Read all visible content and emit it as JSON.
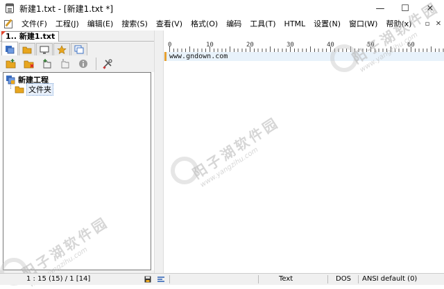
{
  "window": {
    "title": "新建1.txt - [新建1.txt *]",
    "controls": {
      "minimize": "—",
      "maximize": "☐",
      "close": "✕"
    }
  },
  "menu": {
    "items": [
      "文件(F)",
      "工程(J)",
      "编辑(E)",
      "搜索(S)",
      "查看(V)",
      "格式(O)",
      "编码",
      "工具(T)",
      "HTML",
      "设置(N)",
      "窗口(W)",
      "帮助(x)"
    ],
    "restore_icon": "▫",
    "close_icon": "✕"
  },
  "document_tab": {
    "label": "1.. 新建1.txt"
  },
  "panel_tabs": [
    {
      "icon": "project-icon"
    },
    {
      "icon": "folder-icon"
    },
    {
      "icon": "monitor-icon"
    },
    {
      "icon": "star-icon"
    },
    {
      "icon": "windows-icon"
    }
  ],
  "toolbar": {
    "buttons": [
      "add-folder-icon",
      "remove-folder-icon",
      "add-file-icon",
      "remove-file-icon",
      "info-icon",
      "tools-icon"
    ]
  },
  "tree": {
    "project": "新建工程",
    "folder": "文件夹"
  },
  "ruler": {
    "labels": [
      "0",
      "10",
      "20",
      "30",
      "40",
      "50",
      "60"
    ]
  },
  "editor": {
    "lines": [
      "www.gndown.com"
    ]
  },
  "watermark": {
    "text": "阳子湖软件园",
    "url": "www.yangzihu.com"
  },
  "status": {
    "position": "1 : 15 (15) / 1   [14]",
    "type": "Text",
    "line_ending": "DOS",
    "encoding": "ANSI default (0)"
  },
  "colors": {
    "accent": "#e8a030",
    "current_line": "#e8f2fb",
    "chrome": "#f0f0f0"
  }
}
